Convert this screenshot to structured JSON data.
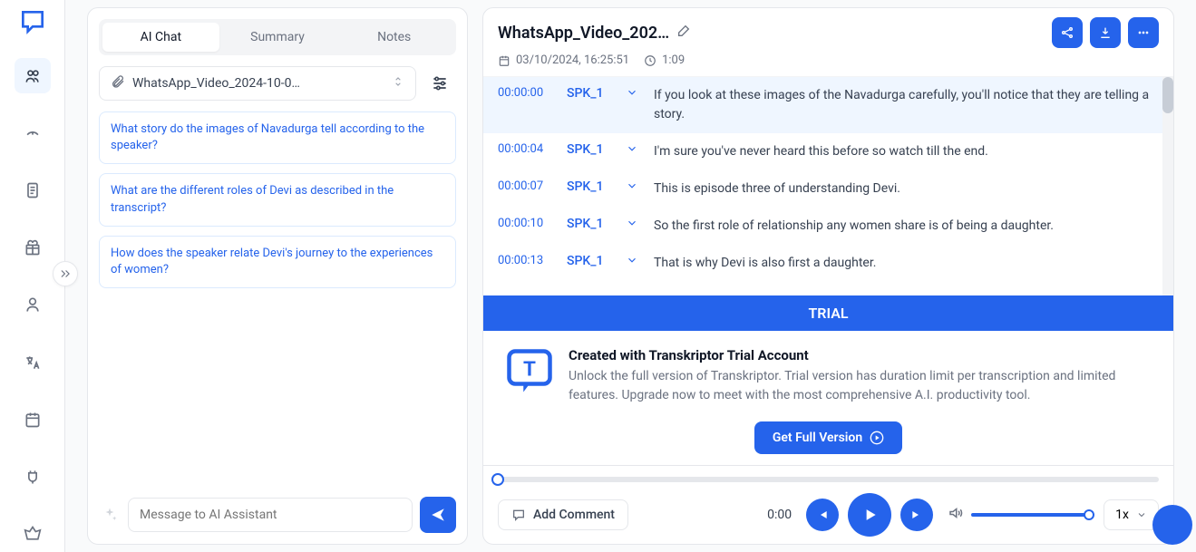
{
  "tabs": {
    "chat": "AI Chat",
    "summary": "Summary",
    "notes": "Notes"
  },
  "file": {
    "name": "WhatsApp_Video_2024-10-0…"
  },
  "suggestions": [
    "What story do the images of Navadurga tell according to the speaker?",
    "What are the different roles of Devi as described in the transcript?",
    "How does the speaker relate Devi's journey to the experiences of women?"
  ],
  "chat_input": {
    "placeholder": "Message to AI Assistant"
  },
  "header": {
    "title": "WhatsApp_Video_202…",
    "date": "03/10/2024, 16:25:51",
    "duration": "1:09"
  },
  "transcript": [
    {
      "time": "00:00:00",
      "speaker": "SPK_1",
      "text": "If you look at these images of the Navadurga carefully, you'll notice that they are telling a story.",
      "active": true
    },
    {
      "time": "00:00:04",
      "speaker": "SPK_1",
      "text": "I'm sure you've never heard this before so watch till the end."
    },
    {
      "time": "00:00:07",
      "speaker": "SPK_1",
      "text": "This is episode three of understanding Devi."
    },
    {
      "time": "00:00:10",
      "speaker": "SPK_1",
      "text": "So the first role of relationship any women share is of being a daughter."
    },
    {
      "time": "00:00:13",
      "speaker": "SPK_1",
      "text": "That is why Devi is also first a daughter."
    }
  ],
  "trial": {
    "banner": "TRIAL",
    "heading": "Created with Transkriptor Trial Account",
    "body": "Unlock the full version of Transkriptor. Trial version has duration limit per transcription and limited features. Upgrade now to meet with the most comprehensive A.I. productivity tool.",
    "cta": "Get Full Version"
  },
  "player": {
    "add_comment": "Add Comment",
    "time": "0:00",
    "speed": "1x"
  }
}
